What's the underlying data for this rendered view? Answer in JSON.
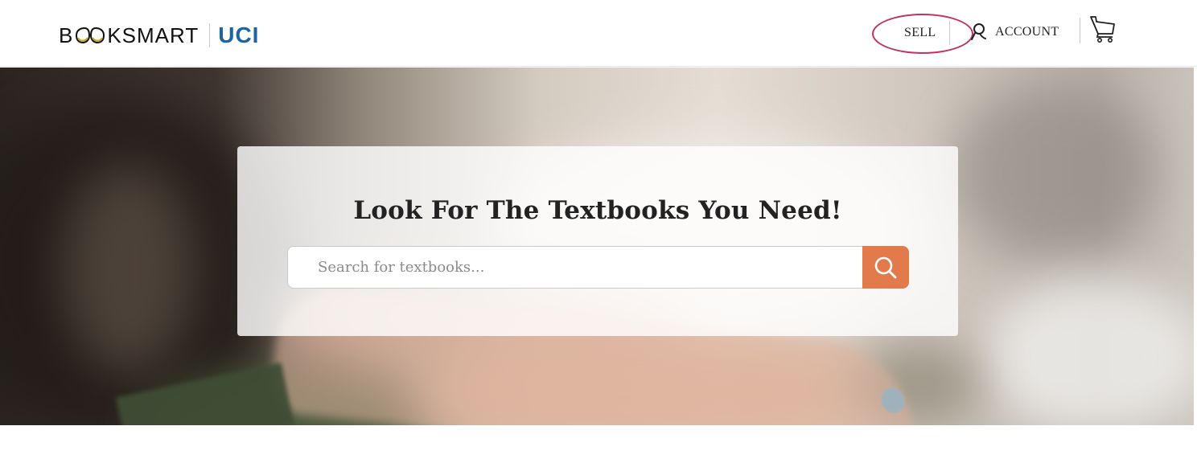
{
  "header": {
    "brand_prefix": "B",
    "brand_suffix": "KSMART",
    "school": "UCI",
    "nav": {
      "sell": "SELL",
      "account": "ACCOUNT"
    },
    "icons": {
      "brand_glasses": "glasses-icon",
      "account": "user-icon",
      "cart": "cart-icon"
    }
  },
  "hero": {
    "headline": "Look For The Textbooks You Need!",
    "search": {
      "placeholder": "Search for textbooks...",
      "value": "",
      "button_icon": "search-icon"
    }
  },
  "colors": {
    "brand_school": "#1d64a4",
    "search_button": "#e27a4c",
    "sell_highlight": "#c2325f",
    "glasses_gold": "#c9a227"
  }
}
